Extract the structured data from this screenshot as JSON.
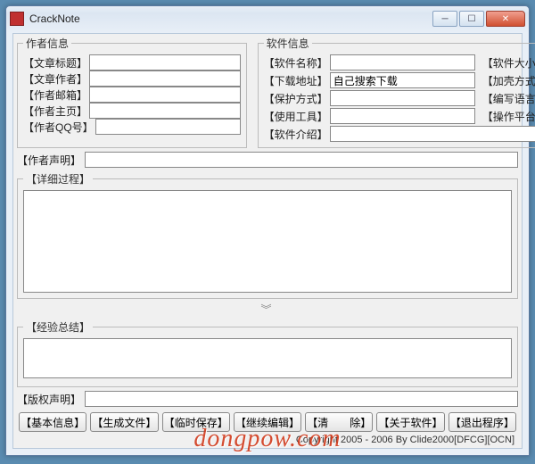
{
  "window": {
    "title": "CrackNote"
  },
  "groups": {
    "author": "作者信息",
    "software": "软件信息",
    "detail": "【详细过程】",
    "summary": "【经验总结】"
  },
  "authorFields": {
    "title": {
      "label": "【文章标题】",
      "value": ""
    },
    "author": {
      "label": "【文章作者】",
      "value": ""
    },
    "email": {
      "label": "【作者邮箱】",
      "value": ""
    },
    "home": {
      "label": "【作者主页】",
      "value": ""
    },
    "qq": {
      "label": "【作者QQ号】",
      "value": ""
    }
  },
  "softFields": {
    "name": {
      "label": "【软件名称】",
      "value": ""
    },
    "download": {
      "label": "【下载地址】",
      "value": "自己搜索下载"
    },
    "protect": {
      "label": "【保护方式】",
      "value": ""
    },
    "tools": {
      "label": "【使用工具】",
      "value": ""
    },
    "intro": {
      "label": "【软件介绍】",
      "value": ""
    },
    "size": {
      "label": "【软件大小】",
      "value": ""
    },
    "pack": {
      "label": "【加壳方式】",
      "value": ""
    },
    "lang": {
      "label": "【编写语言】",
      "value": ""
    },
    "platform": {
      "label": "【操作平台】",
      "value": ""
    }
  },
  "declaration": {
    "label": "【作者声明】",
    "value": ""
  },
  "copyright": {
    "label": "【版权声明】",
    "value": ""
  },
  "detailText": "",
  "summaryText": "",
  "buttons": {
    "basic": "【基本信息】",
    "gen": "【生成文件】",
    "temp": "【临时保存】",
    "cont": "【继续编辑】",
    "clear": "【清　　除】",
    "about": "【关于软件】",
    "exit": "【退出程序】"
  },
  "footer": "Copyright 2005 - 2006       By Clide2000[DFCG][OCN]",
  "watermark": "dongpow.com"
}
